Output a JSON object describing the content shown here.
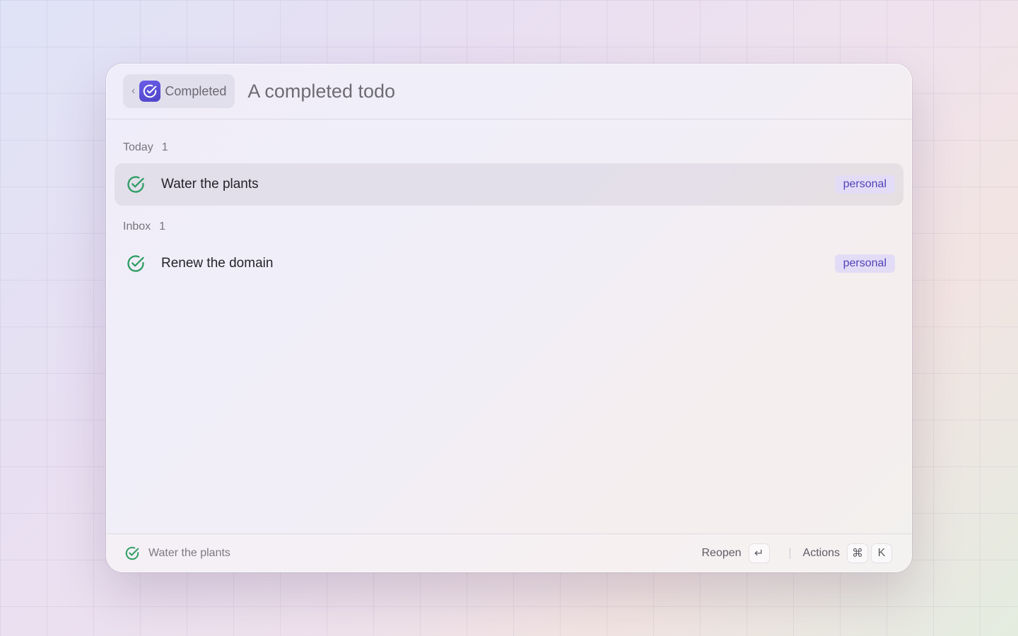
{
  "header": {
    "back_label": "Completed",
    "search_value": "A completed todo",
    "back_chevron": "‹"
  },
  "sections": [
    {
      "title": "Today",
      "count": "1",
      "items": [
        {
          "title": "Water the plants",
          "tag": "personal",
          "icon": "check-circle-icon"
        }
      ]
    },
    {
      "title": "Inbox",
      "count": "1",
      "items": [
        {
          "title": "Renew the domain",
          "tag": "personal",
          "icon": "check-circle-icon"
        }
      ]
    }
  ],
  "footer": {
    "selected_title": "Water the plants",
    "primary_action": "Reopen",
    "primary_key": "↵",
    "secondary_action": "Actions",
    "secondary_keys": [
      "⌘",
      "K"
    ]
  },
  "colors": {
    "accent": "#5b50d6",
    "check_green": "#2f9e63",
    "tag_bg": "#e3dcf6",
    "tag_text": "#5043b8"
  }
}
